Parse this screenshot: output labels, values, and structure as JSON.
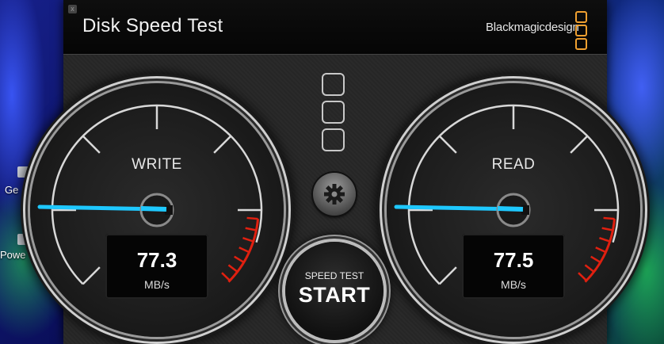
{
  "window": {
    "title": "Disk Speed Test",
    "brand": "Blackmagicdesign",
    "close_label": "x"
  },
  "desktop": {
    "labels": [
      "Ge",
      "Powe"
    ]
  },
  "write": {
    "label": "WRITE",
    "value": "77.3",
    "unit": "MB/s"
  },
  "read": {
    "label": "READ",
    "value": "77.5",
    "unit": "MB/s"
  },
  "controls": {
    "speed_test_label": "SPEED TEST",
    "start_label": "START",
    "settings_icon": "gear-icon",
    "disk_icon": "stacked-squares-icon"
  },
  "colors": {
    "needle": "#1ec8ff",
    "accent": "#f0a030",
    "redzone": "#e02010"
  }
}
